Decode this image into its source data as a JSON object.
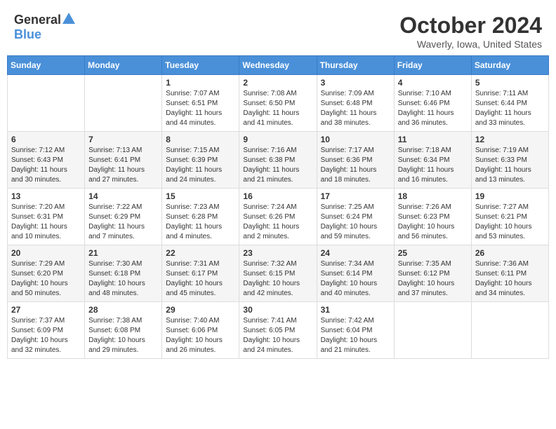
{
  "header": {
    "logo_general": "General",
    "logo_blue": "Blue",
    "month": "October 2024",
    "location": "Waverly, Iowa, United States"
  },
  "weekdays": [
    "Sunday",
    "Monday",
    "Tuesday",
    "Wednesday",
    "Thursday",
    "Friday",
    "Saturday"
  ],
  "weeks": [
    [
      {
        "day": "",
        "info": ""
      },
      {
        "day": "",
        "info": ""
      },
      {
        "day": "1",
        "info": "Sunrise: 7:07 AM\nSunset: 6:51 PM\nDaylight: 11 hours and 44 minutes."
      },
      {
        "day": "2",
        "info": "Sunrise: 7:08 AM\nSunset: 6:50 PM\nDaylight: 11 hours and 41 minutes."
      },
      {
        "day": "3",
        "info": "Sunrise: 7:09 AM\nSunset: 6:48 PM\nDaylight: 11 hours and 38 minutes."
      },
      {
        "day": "4",
        "info": "Sunrise: 7:10 AM\nSunset: 6:46 PM\nDaylight: 11 hours and 36 minutes."
      },
      {
        "day": "5",
        "info": "Sunrise: 7:11 AM\nSunset: 6:44 PM\nDaylight: 11 hours and 33 minutes."
      }
    ],
    [
      {
        "day": "6",
        "info": "Sunrise: 7:12 AM\nSunset: 6:43 PM\nDaylight: 11 hours and 30 minutes."
      },
      {
        "day": "7",
        "info": "Sunrise: 7:13 AM\nSunset: 6:41 PM\nDaylight: 11 hours and 27 minutes."
      },
      {
        "day": "8",
        "info": "Sunrise: 7:15 AM\nSunset: 6:39 PM\nDaylight: 11 hours and 24 minutes."
      },
      {
        "day": "9",
        "info": "Sunrise: 7:16 AM\nSunset: 6:38 PM\nDaylight: 11 hours and 21 minutes."
      },
      {
        "day": "10",
        "info": "Sunrise: 7:17 AM\nSunset: 6:36 PM\nDaylight: 11 hours and 18 minutes."
      },
      {
        "day": "11",
        "info": "Sunrise: 7:18 AM\nSunset: 6:34 PM\nDaylight: 11 hours and 16 minutes."
      },
      {
        "day": "12",
        "info": "Sunrise: 7:19 AM\nSunset: 6:33 PM\nDaylight: 11 hours and 13 minutes."
      }
    ],
    [
      {
        "day": "13",
        "info": "Sunrise: 7:20 AM\nSunset: 6:31 PM\nDaylight: 11 hours and 10 minutes."
      },
      {
        "day": "14",
        "info": "Sunrise: 7:22 AM\nSunset: 6:29 PM\nDaylight: 11 hours and 7 minutes."
      },
      {
        "day": "15",
        "info": "Sunrise: 7:23 AM\nSunset: 6:28 PM\nDaylight: 11 hours and 4 minutes."
      },
      {
        "day": "16",
        "info": "Sunrise: 7:24 AM\nSunset: 6:26 PM\nDaylight: 11 hours and 2 minutes."
      },
      {
        "day": "17",
        "info": "Sunrise: 7:25 AM\nSunset: 6:24 PM\nDaylight: 10 hours and 59 minutes."
      },
      {
        "day": "18",
        "info": "Sunrise: 7:26 AM\nSunset: 6:23 PM\nDaylight: 10 hours and 56 minutes."
      },
      {
        "day": "19",
        "info": "Sunrise: 7:27 AM\nSunset: 6:21 PM\nDaylight: 10 hours and 53 minutes."
      }
    ],
    [
      {
        "day": "20",
        "info": "Sunrise: 7:29 AM\nSunset: 6:20 PM\nDaylight: 10 hours and 50 minutes."
      },
      {
        "day": "21",
        "info": "Sunrise: 7:30 AM\nSunset: 6:18 PM\nDaylight: 10 hours and 48 minutes."
      },
      {
        "day": "22",
        "info": "Sunrise: 7:31 AM\nSunset: 6:17 PM\nDaylight: 10 hours and 45 minutes."
      },
      {
        "day": "23",
        "info": "Sunrise: 7:32 AM\nSunset: 6:15 PM\nDaylight: 10 hours and 42 minutes."
      },
      {
        "day": "24",
        "info": "Sunrise: 7:34 AM\nSunset: 6:14 PM\nDaylight: 10 hours and 40 minutes."
      },
      {
        "day": "25",
        "info": "Sunrise: 7:35 AM\nSunset: 6:12 PM\nDaylight: 10 hours and 37 minutes."
      },
      {
        "day": "26",
        "info": "Sunrise: 7:36 AM\nSunset: 6:11 PM\nDaylight: 10 hours and 34 minutes."
      }
    ],
    [
      {
        "day": "27",
        "info": "Sunrise: 7:37 AM\nSunset: 6:09 PM\nDaylight: 10 hours and 32 minutes."
      },
      {
        "day": "28",
        "info": "Sunrise: 7:38 AM\nSunset: 6:08 PM\nDaylight: 10 hours and 29 minutes."
      },
      {
        "day": "29",
        "info": "Sunrise: 7:40 AM\nSunset: 6:06 PM\nDaylight: 10 hours and 26 minutes."
      },
      {
        "day": "30",
        "info": "Sunrise: 7:41 AM\nSunset: 6:05 PM\nDaylight: 10 hours and 24 minutes."
      },
      {
        "day": "31",
        "info": "Sunrise: 7:42 AM\nSunset: 6:04 PM\nDaylight: 10 hours and 21 minutes."
      },
      {
        "day": "",
        "info": ""
      },
      {
        "day": "",
        "info": ""
      }
    ]
  ]
}
